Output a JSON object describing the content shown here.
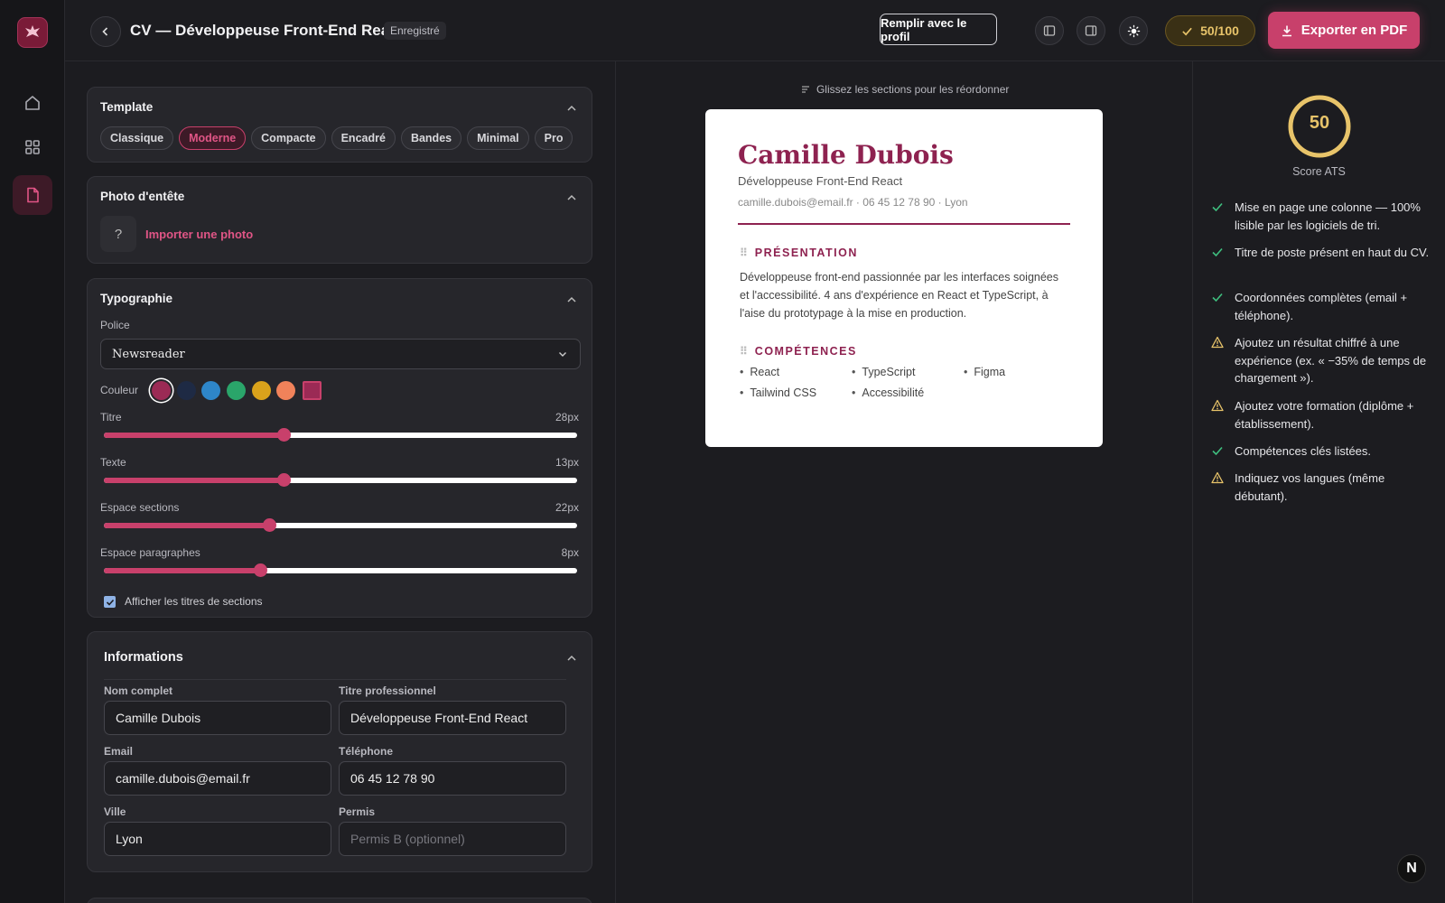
{
  "header": {
    "title": "CV — Développeuse Front-End React",
    "saved_badge": "Enregistré",
    "fill_profile": "Remplir avec le profil",
    "score_button": "50/100",
    "export_button": "Exporter en PDF"
  },
  "template": {
    "heading": "Template",
    "options": [
      "Classique",
      "Moderne",
      "Compacte",
      "Encadré",
      "Bandes",
      "Minimal",
      "Pro"
    ],
    "selected": "Moderne"
  },
  "photo": {
    "heading": "Photo d'entête",
    "placeholder_glyph": "?",
    "import_label": "Importer une photo"
  },
  "typography": {
    "heading": "Typographie",
    "font_label": "Police",
    "font_value": "Newsreader",
    "color_label": "Couleur",
    "colors": [
      "#9b2a55",
      "#1e2a44",
      "#2e86c9",
      "#2aa56a",
      "#d9a21b",
      "#f0825a",
      "#9b2a55"
    ],
    "sliders": [
      {
        "label": "Titre",
        "value_text": "28px",
        "fraction": 0.38
      },
      {
        "label": "Texte",
        "value_text": "13px",
        "fraction": 0.38
      },
      {
        "label": "Espace sections",
        "value_text": "22px",
        "fraction": 0.35
      },
      {
        "label": "Espace paragraphes",
        "value_text": "8px",
        "fraction": 0.33
      }
    ],
    "show_titles_label": "Afficher les titres de sections",
    "show_titles_checked": true
  },
  "info": {
    "heading": "Informations",
    "fields": {
      "name_label": "Nom complet",
      "name_value": "Camille Dubois",
      "title_label": "Titre professionnel",
      "title_value": "Développeuse Front-End React",
      "email_label": "Email",
      "email_value": "camille.dubois@email.fr",
      "phone_label": "Téléphone",
      "phone_value": "06 45 12 78 90",
      "city_label": "Ville",
      "city_value": "Lyon",
      "license_label": "Permis",
      "license_placeholder": "Permis B (optionnel)"
    }
  },
  "preview": {
    "hint": "Glissez les sections pour les réordonner",
    "name": "Camille Dubois",
    "role": "Développeuse Front-End React",
    "contact": "camille.dubois@email.fr · 06 45 12 78 90 · Lyon",
    "sections": {
      "presentation_title": "PRÉSENTATION",
      "presentation_text": "Développeuse front-end passionnée par les interfaces soignées et l'accessibilité. 4 ans d'expérience en React et TypeScript, à l'aise du prototypage à la mise en production.",
      "skills_title": "COMPÉTENCES",
      "skills": [
        "React",
        "TypeScript",
        "Figma",
        "Tailwind CSS",
        "Accessibilité"
      ]
    }
  },
  "ats": {
    "score": "50",
    "score_label": "Score ATS",
    "score_fraction": 1.0,
    "checks": [
      {
        "status": "ok",
        "text": "Mise en page une colonne — 100% lisible par les logiciels de tri."
      },
      {
        "status": "ok",
        "text": "Titre de poste présent en haut du CV."
      },
      {
        "status": "ok",
        "text": "Coordonnées complètes (email + téléphone)."
      },
      {
        "status": "warn",
        "text": "Ajoutez un résultat chiffré à une expérience (ex. « −35% de temps de chargement »)."
      },
      {
        "status": "warn",
        "text": "Ajoutez votre formation (diplôme + établissement)."
      },
      {
        "status": "ok",
        "text": "Compétences clés listées."
      },
      {
        "status": "warn",
        "text": "Indiquez vos langues (même débutant)."
      }
    ]
  },
  "fab_label": "N",
  "colors": {
    "accent": "#c8406b",
    "cv_accent": "#8e2250",
    "ok": "#3fbf7f",
    "warn": "#e8c46a"
  }
}
